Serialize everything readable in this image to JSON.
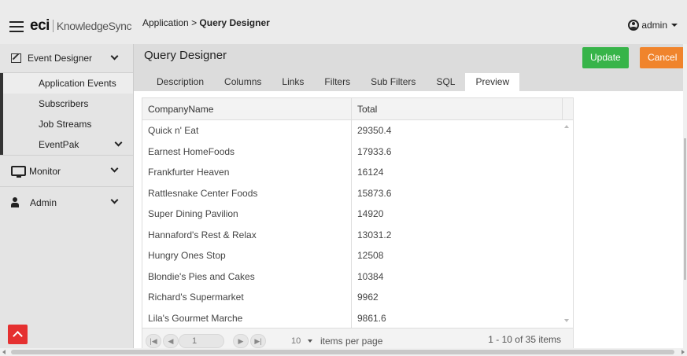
{
  "header": {
    "logo_eci": "eci",
    "logo_product": "KnowledgeSync",
    "breadcrumb_parent": "Application",
    "breadcrumb_sep": ">",
    "breadcrumb_current": "Query Designer",
    "user_label": "admin",
    "user_icon": "user-circle-icon"
  },
  "sidebar": {
    "event_designer": "Event Designer",
    "sub_items": [
      {
        "label": "Application Events",
        "selected": true
      },
      {
        "label": "Subscribers",
        "selected": false
      },
      {
        "label": "Job Streams",
        "selected": false
      },
      {
        "label": "EventPak",
        "selected": false
      }
    ],
    "monitor": "Monitor",
    "admin": "Admin"
  },
  "main": {
    "title": "Query Designer",
    "update_label": "Update",
    "cancel_label": "Cancel",
    "colors": {
      "update": "#37b449",
      "cancel": "#f0842c",
      "scroll_top": "#e53030"
    },
    "tabs": [
      {
        "label": "Description",
        "active": false
      },
      {
        "label": "Columns",
        "active": false
      },
      {
        "label": "Links",
        "active": false
      },
      {
        "label": "Filters",
        "active": false
      },
      {
        "label": "Sub Filters",
        "active": false
      },
      {
        "label": "SQL",
        "active": false
      },
      {
        "label": "Preview",
        "active": true
      }
    ]
  },
  "grid": {
    "columns": [
      "CompanyName",
      "Total"
    ],
    "rows": [
      [
        "Quick n' Eat",
        "29350.4"
      ],
      [
        "Earnest HomeFoods",
        "17933.6"
      ],
      [
        "Frankfurter Heaven",
        "16124"
      ],
      [
        "Rattlesnake Center Foods",
        "15873.6"
      ],
      [
        "Super Dining Pavilion",
        "14920"
      ],
      [
        "Hannaford's Rest & Relax",
        "13031.2"
      ],
      [
        "Hungry Ones Stop",
        "12508"
      ],
      [
        "Blondie's Pies and Cakes",
        "10384"
      ],
      [
        "Richard's Supermarket",
        "9962"
      ],
      [
        "Lila's Gourmet Marche",
        "9861.6"
      ]
    ],
    "pager": {
      "page": "1",
      "page_size": "10",
      "items_per_page_label": "items per page",
      "info": "1 - 10 of 35 items"
    }
  }
}
